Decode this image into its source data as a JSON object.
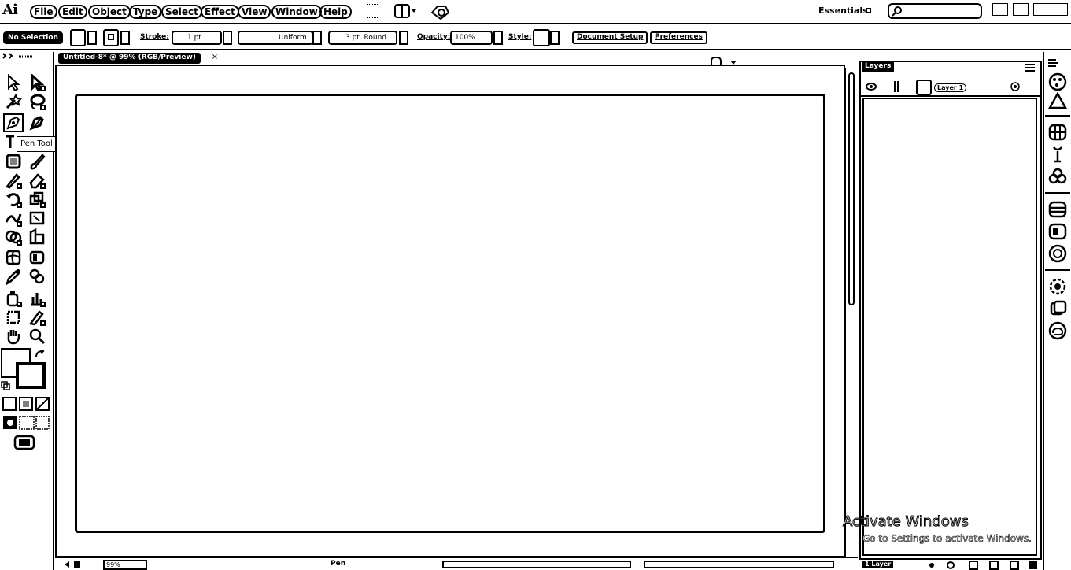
{
  "app": {
    "logo": "Ai"
  },
  "menu": [
    "File",
    "Edit",
    "Object",
    "Type",
    "Select",
    "Effect",
    "View",
    "Window",
    "Help"
  ],
  "workspace": {
    "label": "Essentials"
  },
  "search": {
    "placeholder": ""
  },
  "control": {
    "selection": "No Selection",
    "stroke_label": "Stroke:",
    "stroke_weight": "1 pt",
    "profile": "Uniform",
    "brush": "3 pt. Round",
    "opacity_label": "Opacity:",
    "opacity": "100%",
    "style_label": "Style:",
    "document_setup": "Document Setup",
    "preferences": "Preferences"
  },
  "document": {
    "tab_title": "Untitled-8* @ 99% (RGB/Preview)",
    "close": "×"
  },
  "tooltip": {
    "text": "Pen Tool (P)"
  },
  "status": {
    "zoom": "99%",
    "tool": "Pen"
  },
  "layers": {
    "tab": "Layers",
    "items": [
      {
        "name": "Layer 1"
      }
    ],
    "count": "1 Layer"
  },
  "watermark": {
    "title": "Activate Windows",
    "subtitle": "Go to Settings to activate Windows."
  }
}
